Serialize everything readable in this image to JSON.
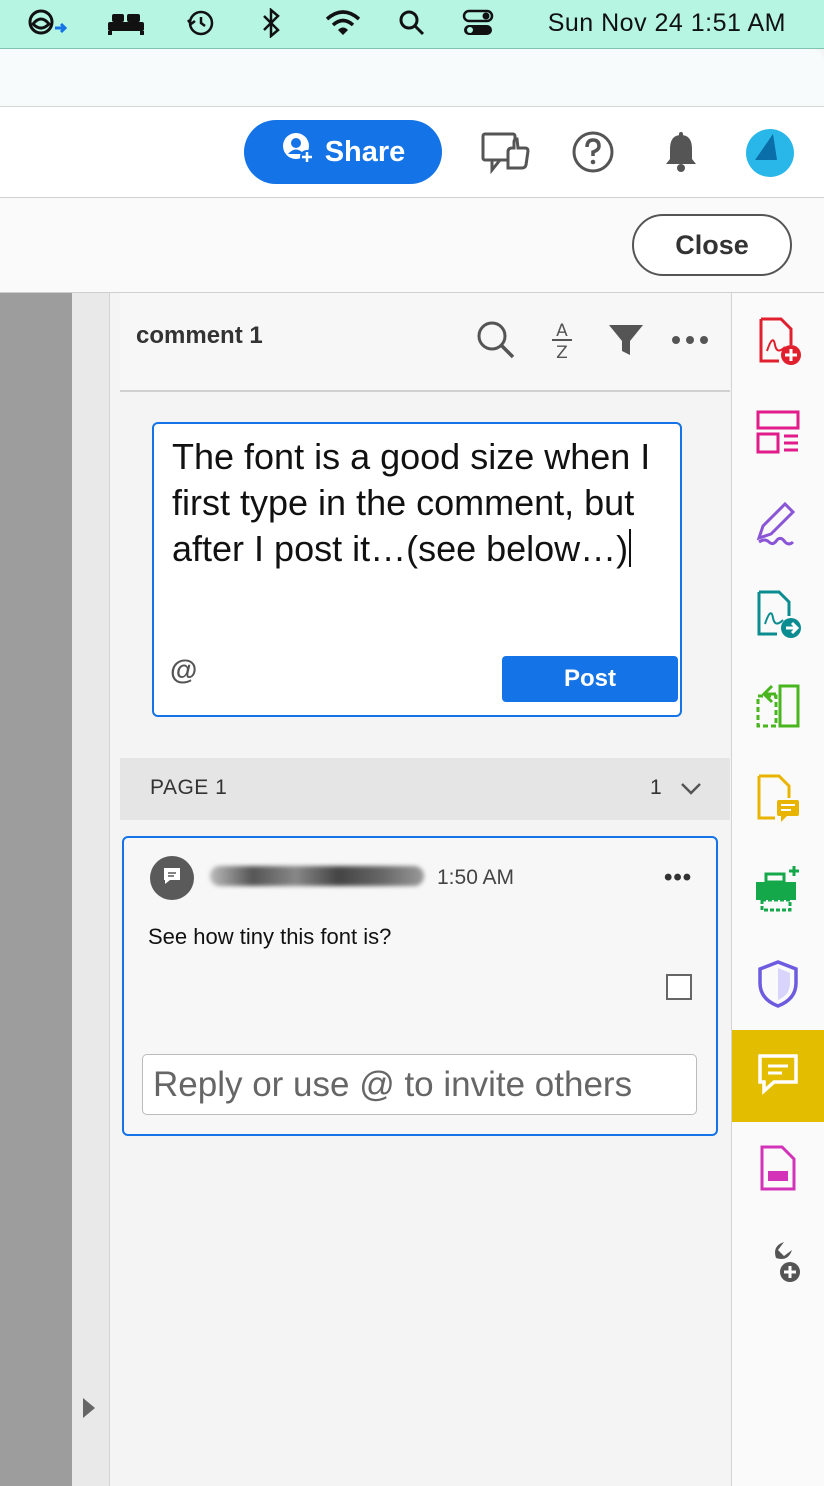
{
  "menubar": {
    "clock": "Sun Nov 24  1:51 AM",
    "icons": [
      "creative-cloud-icon",
      "bed-icon",
      "time-machine-icon",
      "bluetooth-icon",
      "wifi-icon",
      "spotlight-search-icon",
      "control-center-icon"
    ]
  },
  "toolbar": {
    "share_label": "Share",
    "icons": [
      "review-icon",
      "help-icon",
      "bell-icon",
      "profile-avatar"
    ]
  },
  "close_label": "Close",
  "panel": {
    "title": "comment 1",
    "header_icons": [
      "search-icon",
      "sort-az-icon",
      "filter-icon",
      "more-icon"
    ],
    "composer": {
      "text": "The font is a good size when I first type in the comment, but after I post it…(see below…)",
      "mention": "@",
      "post_label": "Post"
    },
    "page_group": {
      "label": "PAGE 1",
      "count": "1"
    },
    "comment": {
      "time": "1:50 AM",
      "more": "•••",
      "text": "See how tiny this font is?",
      "reply_placeholder": "Reply or use @ to invite others"
    }
  },
  "rail_tools": [
    {
      "name": "create-pdf-icon",
      "color": "#e0202e"
    },
    {
      "name": "organize-pages-icon",
      "color": "#e21a8a"
    },
    {
      "name": "fill-sign-icon",
      "color": "#8a55d6"
    },
    {
      "name": "export-pdf-icon",
      "color": "#0b8c91"
    },
    {
      "name": "compare-files-icon",
      "color": "#49b51f"
    },
    {
      "name": "request-signatures-icon",
      "color": "#e8b400"
    },
    {
      "name": "scan-ocr-icon",
      "color": "#14a84a"
    },
    {
      "name": "protect-icon",
      "color": "#6d5be0"
    },
    {
      "name": "comment-icon",
      "color": "#ffffff",
      "active": true
    },
    {
      "name": "redact-icon",
      "color": "#d233b8"
    },
    {
      "name": "more-tools-icon",
      "color": "#555555"
    }
  ]
}
